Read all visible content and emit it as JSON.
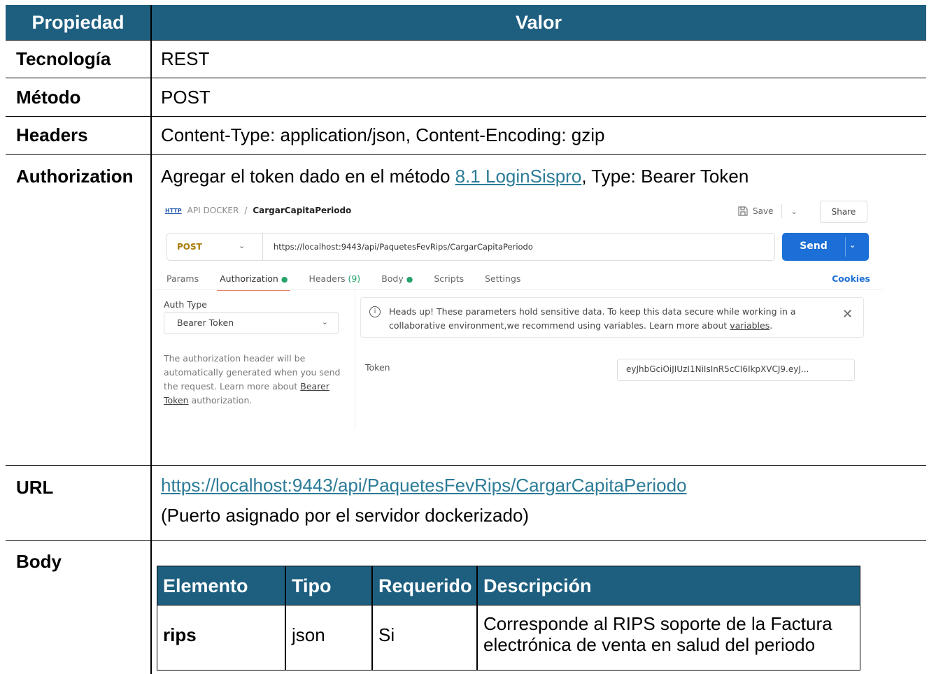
{
  "header": {
    "prop": "Propiedad",
    "val": "Valor"
  },
  "rows": {
    "tecnologia": {
      "label": "Tecnología",
      "value": "REST"
    },
    "metodo": {
      "label": "Método",
      "value": "POST"
    },
    "headers": {
      "label": "Headers",
      "value": "Content-Type: application/json, Content-Encoding: gzip"
    },
    "authorization": {
      "label": "Authorization",
      "text_before": "Agregar el token dado en el método ",
      "link": "8.1 LoginSispro",
      "text_after": ", Type: Bearer Token"
    },
    "url": {
      "label": "URL",
      "link": "https://localhost:9443/api/PaquetesFevRips/CargarCapitaPeriodo",
      "note": "(Puerto asignado por el servidor dockerizado)"
    },
    "body": {
      "label": "Body"
    }
  },
  "postman": {
    "http_icon": "HTTP",
    "collection": "API DOCKER",
    "separator": "/",
    "request_name": "CargarCapitaPeriodo",
    "save": "Save",
    "share": "Share",
    "method": "POST",
    "url": "https://localhost:9443/api/PaquetesFevRips/CargarCapitaPeriodo",
    "send": "Send",
    "tabs": {
      "params": "Params",
      "authorization": "Authorization",
      "headers": "Headers",
      "headers_count": "(9)",
      "body": "Body",
      "scripts": "Scripts",
      "settings": "Settings"
    },
    "cookies": "Cookies",
    "auth_type_label": "Auth Type",
    "auth_type_value": "Bearer Token",
    "desc_part1": "The authorization header will be automatically generated when you send the request. Learn more about ",
    "desc_link": "Bearer Token",
    "desc_part2": " authorization.",
    "alert_text": "Heads up! These parameters hold sensitive data. To keep this data secure while working in a collaborative environment,we recommend using variables. Learn more about ",
    "alert_link": "variables",
    "alert_end": ".",
    "token_label": "Token",
    "token_value": "eyJhbGciOiJIUzI1NiIsInR5cCI6IkpXVCJ9.eyJ..."
  },
  "body_table": {
    "headers": [
      "Elemento",
      "Tipo",
      "Requerido",
      "Descripción"
    ],
    "rows": [
      {
        "elemento": "rips",
        "tipo": "json",
        "requerido": "Si",
        "descripcion": "Corresponde al RIPS soporte de la Factura electrónica de venta en salud del periodo"
      }
    ]
  }
}
